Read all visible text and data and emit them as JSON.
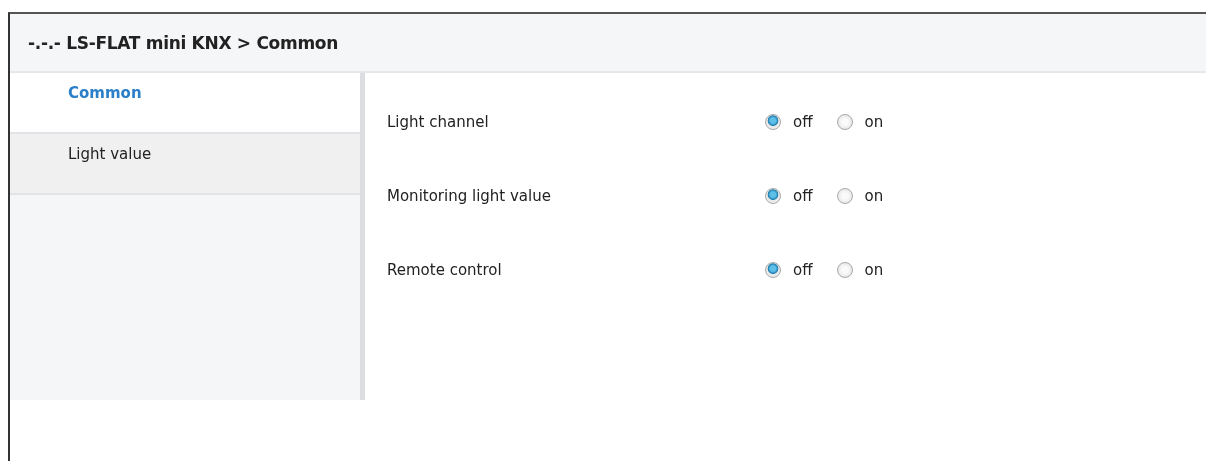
{
  "window": {
    "title": "-.-.- LS-FLAT mini KNX > Common"
  },
  "sidebar": {
    "items": [
      {
        "label": "Common",
        "selected": true
      },
      {
        "label": "Light value",
        "selected": false
      }
    ]
  },
  "parameters": [
    {
      "label": "Light channel",
      "options": [
        {
          "label": "off",
          "selected": true
        },
        {
          "label": "on",
          "selected": false
        }
      ]
    },
    {
      "label": "Monitoring light value",
      "options": [
        {
          "label": "off",
          "selected": true
        },
        {
          "label": "on",
          "selected": false
        }
      ]
    },
    {
      "label": "Remote control",
      "options": [
        {
          "label": "off",
          "selected": true
        },
        {
          "label": "on",
          "selected": false
        }
      ]
    }
  ]
}
